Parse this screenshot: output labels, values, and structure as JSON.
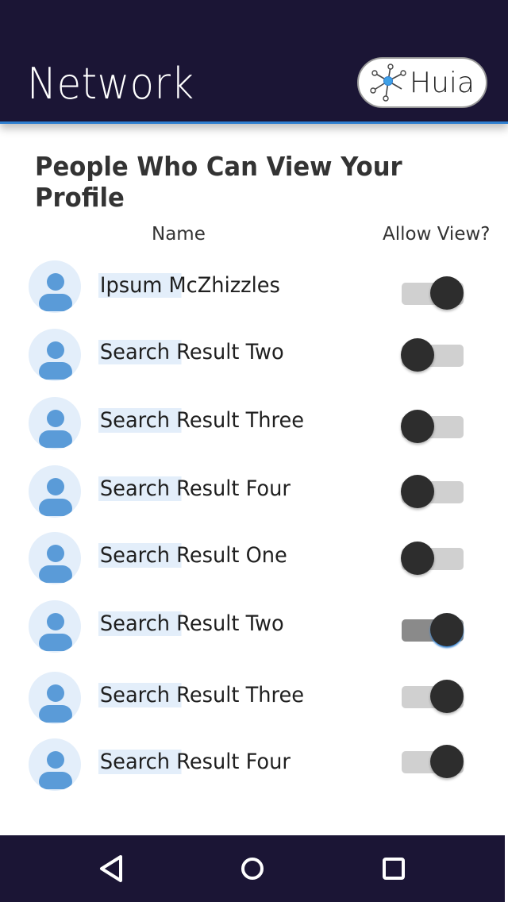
{
  "app_bar": {
    "title": "Network",
    "brand": {
      "name": "Huia",
      "icon": "network-node-icon"
    }
  },
  "section": {
    "heading": "People Who Can View Your Profile"
  },
  "columns": {
    "name": "Name",
    "allow_view": "Allow View?"
  },
  "people": [
    {
      "name": "Ipsum McZhizzles",
      "allow_view": true
    },
    {
      "name": "Search Result Two",
      "allow_view": false
    },
    {
      "name": "Search Result Three",
      "allow_view": false
    },
    {
      "name": "Search Result Four",
      "allow_view": false
    },
    {
      "name": "Search Result One",
      "allow_view": false
    },
    {
      "name": "Search Result Two",
      "allow_view": true
    },
    {
      "name": "Search Result Three",
      "allow_view": true
    },
    {
      "name": "Search Result Four",
      "allow_view": true
    }
  ],
  "nav": {
    "back_icon": "back-triangle-icon",
    "home_icon": "home-circle-icon",
    "recents_icon": "recents-square-icon"
  },
  "colors": {
    "app_bar": "#1b1535",
    "accent": "#2f7fd0",
    "avatar_bg": "#e3eefa",
    "avatar_fg": "#5a9bd8",
    "knob": "#2d2d2d",
    "track": "#d0d0d0"
  }
}
